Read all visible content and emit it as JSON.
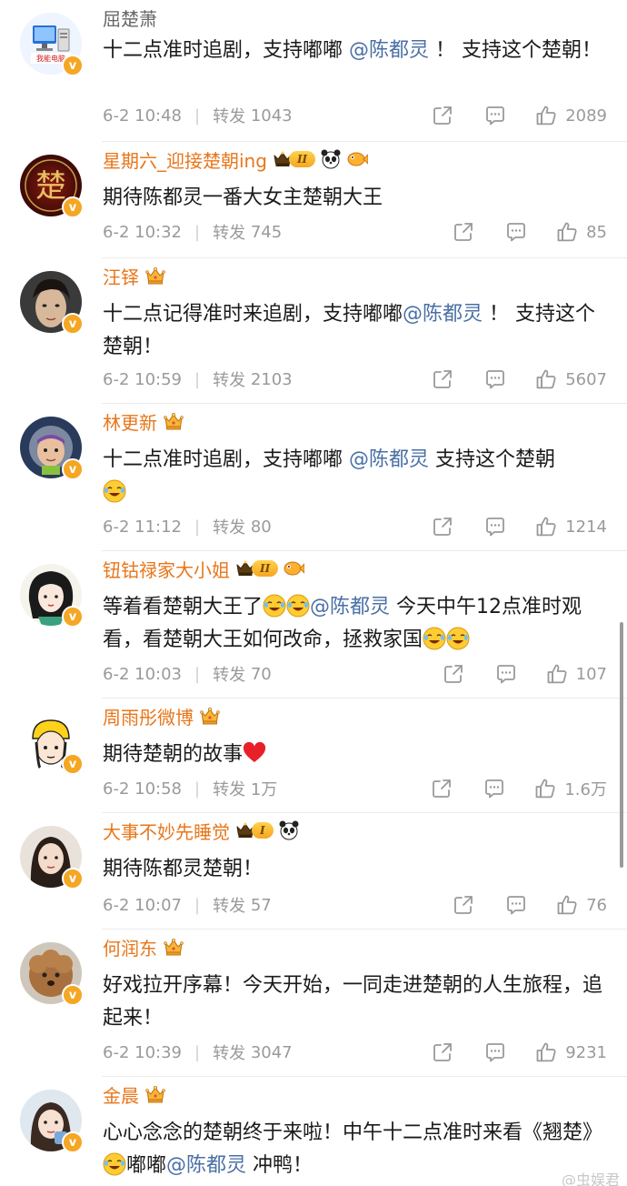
{
  "comments": [
    {
      "user": "屈楚萧",
      "text_parts": [
        "十二点准时追剧，支持嘟嘟 ",
        "@陈都灵",
        " ！ 支持这个楚朝！"
      ],
      "time": "6-2 10:48",
      "repost_label": "转发",
      "repost_count": "1043",
      "like_count": "2089"
    },
    {
      "user": "星期六_迎接楚朝ing",
      "level": "II",
      "text_parts": [
        "期待陈都灵一番大女主楚朝大王"
      ],
      "time": "6-2 10:32",
      "repost_label": "转发",
      "repost_count": "745",
      "like_count": "85"
    },
    {
      "user": "汪铎",
      "text_parts": [
        "十二点记得准时来追剧，支持嘟嘟",
        "@陈都灵",
        " ！ 支持这个楚朝！"
      ],
      "time": "6-2 10:59",
      "repost_label": "转发",
      "repost_count": "2103",
      "like_count": "5607"
    },
    {
      "user": "林更新",
      "text_parts": [
        "十二点准时追剧，支持嘟嘟 ",
        "@陈都灵",
        "  支持这个楚朝"
      ],
      "time": "6-2 11:12",
      "repost_label": "转发",
      "repost_count": "80",
      "like_count": "1214"
    },
    {
      "user": "钮钴禄家大小姐",
      "level": "II",
      "text_parts": [
        "等着看楚朝大王了",
        "@陈都灵",
        "  今天中午12点准时观看，看楚朝大王如何改命，拯救家国"
      ],
      "time": "6-2 10:03",
      "repost_label": "转发",
      "repost_count": "70",
      "like_count": "107"
    },
    {
      "user": "周雨彤微博",
      "text_parts": [
        "期待楚朝的故事"
      ],
      "time": "6-2 10:58",
      "repost_label": "转发",
      "repost_count": "1万",
      "like_count": "1.6万"
    },
    {
      "user": "大事不妙先睡觉",
      "level": "I",
      "text_parts": [
        "期待陈都灵楚朝！"
      ],
      "time": "6-2 10:07",
      "repost_label": "转发",
      "repost_count": "57",
      "like_count": "76"
    },
    {
      "user": "何润东",
      "text_parts": [
        "好戏拉开序幕！今天开始，一同走进楚朝的人生旅程，追起来！"
      ],
      "time": "6-2 10:39",
      "repost_label": "转发",
      "repost_count": "3047",
      "like_count": "9231"
    },
    {
      "user": "金晨",
      "text_parts": [
        "心心念念的楚朝终于来啦！中午十二点准时来看《翘楚》",
        "嘟嘟",
        "@陈都灵",
        " 冲鸭！"
      ]
    }
  ],
  "avatar_text_0": "我能电脑",
  "avatar_text_1": "楚",
  "watermark": "@虫娱君",
  "colors": {
    "username": "#e8761a",
    "mention": "#4a6fa5",
    "vip_badge": "#f5a623",
    "meta_text": "#9a9a9a"
  },
  "icons": [
    "share-icon",
    "comment-icon",
    "like-icon",
    "crown-icon",
    "verified-v-icon"
  ]
}
